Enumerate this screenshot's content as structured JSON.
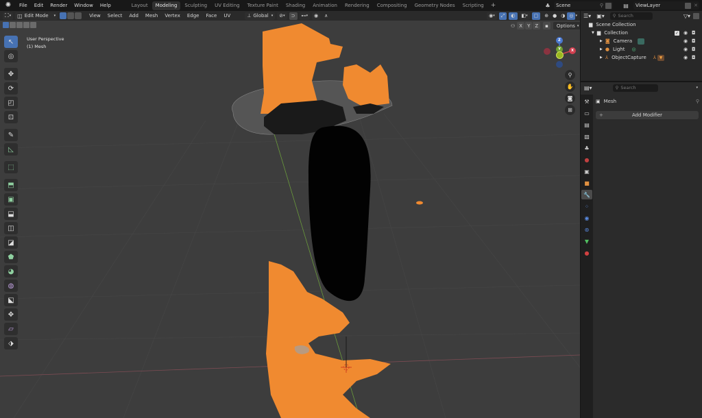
{
  "app": {
    "name": "Blender"
  },
  "topbar": {
    "menus": [
      "File",
      "Edit",
      "Render",
      "Window",
      "Help"
    ],
    "workspace_tabs": [
      "Layout",
      "Modeling",
      "Sculpting",
      "UV Editing",
      "Texture Paint",
      "Shading",
      "Animation",
      "Rendering",
      "Compositing",
      "Geometry Nodes",
      "Scripting"
    ],
    "active_workspace": "Modeling",
    "add_tab_label": "+",
    "scene_name": "Scene",
    "view_layer_name": "ViewLayer"
  },
  "viewport": {
    "mode": "Edit Mode",
    "menus": [
      "View",
      "Select",
      "Add",
      "Mesh",
      "Vertex",
      "Edge",
      "Face",
      "UV"
    ],
    "transform_orientation": "Global",
    "axis_labels": [
      "X",
      "Y",
      "Z"
    ],
    "options_label": "Options",
    "info_line1": "User Perspective",
    "info_line2": "(1) Mesh",
    "gizmo": {
      "x": "X",
      "y": "Y",
      "z": "Z"
    },
    "colors": {
      "background": "#3d3d3d",
      "mesh": "#f08a30",
      "active_blue": "#4772b3"
    }
  },
  "toolbar": {
    "tools": [
      {
        "name": "select-box",
        "glyph": "↖"
      },
      {
        "name": "cursor",
        "glyph": "◎"
      },
      {
        "name": "move",
        "glyph": "✥"
      },
      {
        "name": "rotate",
        "glyph": "⟳"
      },
      {
        "name": "scale",
        "glyph": "◰"
      },
      {
        "name": "transform",
        "glyph": "⊡"
      },
      {
        "name": "annotate",
        "glyph": "✎"
      },
      {
        "name": "measure",
        "glyph": "📐"
      },
      {
        "name": "add-cube",
        "glyph": "⬚"
      },
      {
        "name": "extrude",
        "glyph": "⬒"
      },
      {
        "name": "inset",
        "glyph": "▣"
      },
      {
        "name": "bevel",
        "glyph": "⬓"
      },
      {
        "name": "loop-cut",
        "glyph": "◫"
      },
      {
        "name": "knife",
        "glyph": "◪"
      },
      {
        "name": "poly-build",
        "glyph": "⬟"
      },
      {
        "name": "spin",
        "glyph": "◕"
      },
      {
        "name": "smooth",
        "glyph": "◍"
      },
      {
        "name": "edge-slide",
        "glyph": "⬕"
      },
      {
        "name": "shrink-fatten",
        "glyph": "✥"
      },
      {
        "name": "shear",
        "glyph": "▱"
      },
      {
        "name": "rip",
        "glyph": "⬗"
      }
    ]
  },
  "outliner": {
    "search_placeholder": "Search",
    "items": [
      {
        "label": "Scene Collection",
        "level": 0
      },
      {
        "label": "Collection",
        "level": 1
      },
      {
        "label": "Camera",
        "level": 2
      },
      {
        "label": "Light",
        "level": 2
      },
      {
        "label": "ObjectCapture",
        "level": 2
      }
    ]
  },
  "properties": {
    "search_placeholder": "Search",
    "object_name": "Mesh",
    "add_modifier_label": "Add Modifier",
    "add_icon": "+"
  }
}
